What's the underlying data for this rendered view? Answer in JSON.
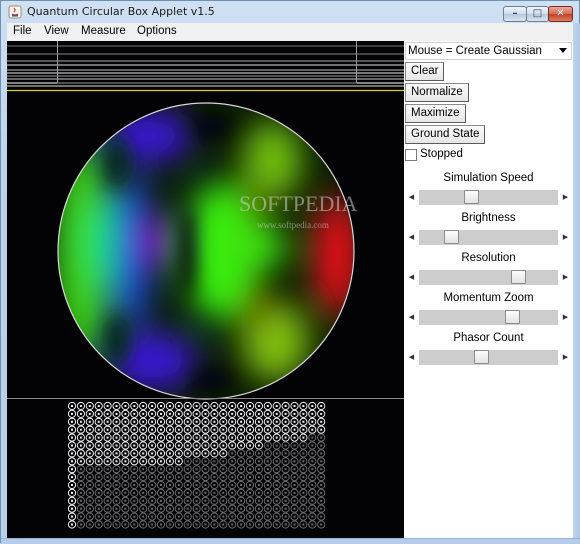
{
  "window": {
    "title": "Quantum Circular Box Applet v1.5",
    "controls": {
      "minimize": "–",
      "maximize": "□",
      "close": "✕"
    }
  },
  "menu": [
    "File",
    "View",
    "Measure",
    "Options"
  ],
  "panel": {
    "mouse_mode": "Mouse = Create Gaussian",
    "buttons": [
      "Clear",
      "Normalize",
      "Maximize",
      "Ground State"
    ],
    "stopped": {
      "label": "Stopped",
      "checked": false
    },
    "sliders": [
      {
        "label": "Simulation Speed",
        "value": 0.36
      },
      {
        "label": "Brightness",
        "value": 0.2
      },
      {
        "label": "Resolution",
        "value": 0.74
      },
      {
        "label": "Momentum Zoom",
        "value": 0.69
      },
      {
        "label": "Phasor Count",
        "value": 0.44
      }
    ]
  },
  "canvas": {
    "watermark": "SOFTPEDIA",
    "watermark_url": "www.softpedia.com",
    "colors": {
      "background": "#030305",
      "energy_line": "#d9d21c",
      "circle_border": "#d8d8d8"
    }
  }
}
